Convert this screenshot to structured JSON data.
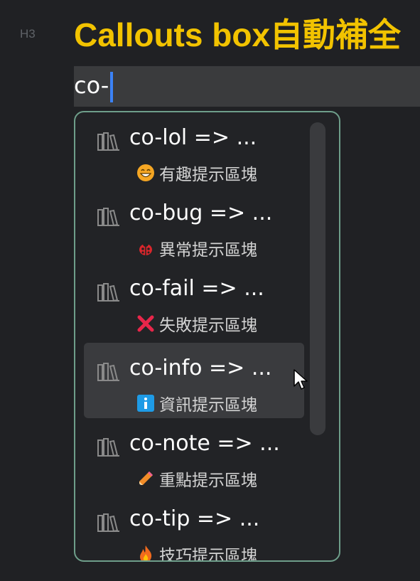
{
  "heading": {
    "level": "H3",
    "title": "Callouts box自動補全"
  },
  "editor": {
    "text": "co-"
  },
  "suggestions": [
    {
      "title": "co-lol => ...",
      "description": "有趣提示區塊",
      "icon": "grinning-face-icon"
    },
    {
      "title": "co-bug => ...",
      "description": "異常提示區塊",
      "icon": "ladybug-icon"
    },
    {
      "title": "co-fail => ...",
      "description": "失敗提示區塊",
      "icon": "cross-mark-icon"
    },
    {
      "title": "co-info => ...",
      "description": "資訊提示區塊",
      "icon": "info-icon"
    },
    {
      "title": "co-note => ...",
      "description": "重點提示區塊",
      "icon": "pencil-icon"
    },
    {
      "title": "co-tip => ...",
      "description": "技巧提示區塊",
      "icon": "fire-icon"
    }
  ],
  "selected_index": 3,
  "colors": {
    "heading": "#f2c300",
    "caret": "#3b82f6",
    "popup_border": "#6e9e8a"
  }
}
